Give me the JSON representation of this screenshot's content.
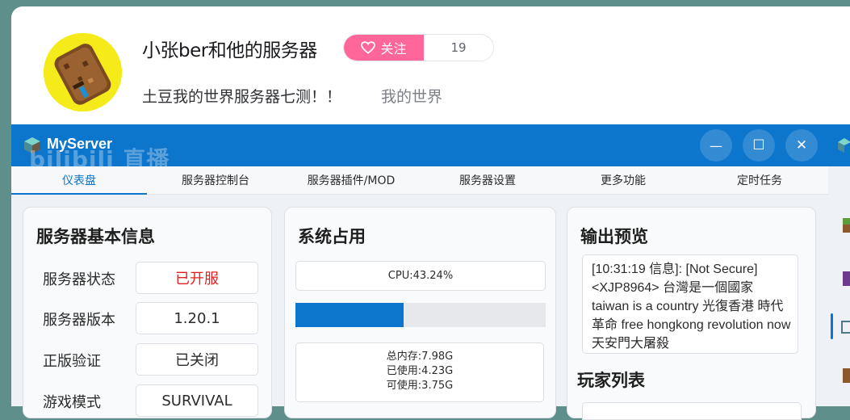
{
  "stream": {
    "title": "小张ber和他的服务器",
    "follow_label": "关注",
    "follower_count": "19",
    "subtitle": "土豆我的世界服务器七测！！",
    "category": "我的世界"
  },
  "app": {
    "name": "MyServer",
    "watermark": "bilibili 直播",
    "window_buttons": {
      "minimize": "—",
      "maximize": "☐",
      "close": "✕"
    },
    "tabs": [
      {
        "label": "仪表盘",
        "active": true
      },
      {
        "label": "服务器控制台",
        "active": false
      },
      {
        "label": "服务器插件/MOD",
        "active": false
      },
      {
        "label": "服务器设置",
        "active": false
      },
      {
        "label": "更多功能",
        "active": false
      },
      {
        "label": "定时任务",
        "active": false
      }
    ],
    "basic_info": {
      "title": "服务器基本信息",
      "rows": [
        {
          "label": "服务器状态",
          "value": "已开服"
        },
        {
          "label": "服务器版本",
          "value": "1.20.1"
        },
        {
          "label": "正版验证",
          "value": "已关闭"
        },
        {
          "label": "游戏模式",
          "value": "SURVIVAL"
        }
      ]
    },
    "system_usage": {
      "title": "系统占用",
      "cpu_text": "CPU:43.24%",
      "cpu_fraction": 0.4324,
      "mem_total": "总内存:7.98G",
      "mem_used": "已使用:4.23G",
      "mem_free": "可使用:3.75G"
    },
    "output_preview": {
      "title": "输出预览",
      "log_text": "[10:31:19 信息]: [Not Secure] <XJP8964> 台灣是一個國家 taiwan is a country 光復香港 時代革命 free hongkong revolution now 天安門大屠殺",
      "player_list_title": "玩家列表"
    },
    "colors": {
      "accent": "#0c75cc",
      "follow_pink": "#ff6699",
      "status_red": "#e02020"
    }
  }
}
